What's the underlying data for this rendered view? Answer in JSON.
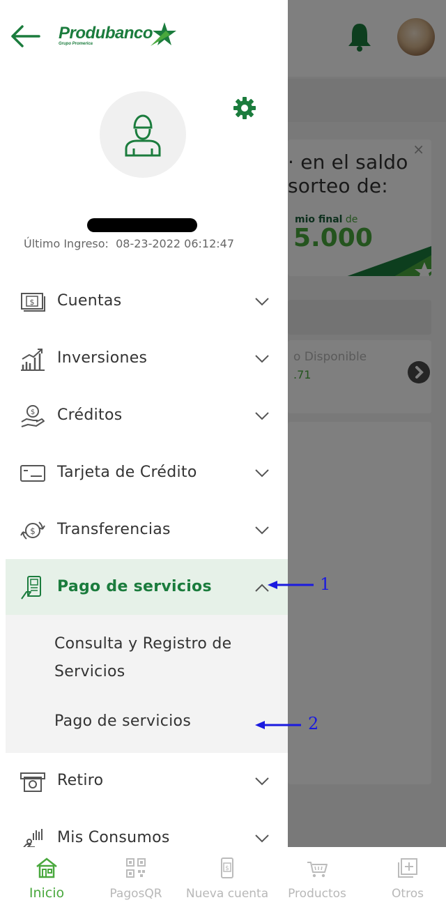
{
  "background": {
    "promo": {
      "close": "×",
      "line1": "· en el saldo",
      "line2": "sorteo de:",
      "prize_bold": "mio final",
      "prize_de": "de",
      "amount": "5.000"
    },
    "account": {
      "label": "o Disponible",
      "value": ".71"
    }
  },
  "drawer": {
    "last_login_label": "Último Ingreso:",
    "last_login_value": "08-23-2022 06:12:47",
    "logo_text": "Produbanco",
    "logo_sub": "Grupo Promerica",
    "menu": [
      {
        "label": "Cuentas",
        "icon": "cash-icon"
      },
      {
        "label": "Inversiones",
        "icon": "investment-chart-icon"
      },
      {
        "label": "Créditos",
        "icon": "credit-hand-icon"
      },
      {
        "label": "Tarjeta de Crédito",
        "icon": "credit-card-icon"
      },
      {
        "label": "Transferencias",
        "icon": "transfer-icon"
      },
      {
        "label": "Pago de servicios",
        "icon": "service-payment-icon",
        "expanded": true
      },
      {
        "label": "Retiro",
        "icon": "withdrawal-icon"
      },
      {
        "label": "Mis Consumos",
        "icon": "consumption-icon"
      }
    ],
    "submenu": {
      "item1": "Consulta y Registro de Servicios",
      "item2": "Pago de servicios"
    }
  },
  "annotations": {
    "marker1": "1",
    "marker2": "2"
  },
  "bottom_nav": [
    {
      "label": "Inicio",
      "icon": "home-icon",
      "active": true
    },
    {
      "label": "PagosQR",
      "icon": "qr-code-icon"
    },
    {
      "label": "Nueva cuenta",
      "icon": "new-account-icon"
    },
    {
      "label": "Productos",
      "icon": "cart-icon"
    },
    {
      "label": "Otros",
      "icon": "more-icon"
    }
  ],
  "colors": {
    "brand_green": "#1b7c3d",
    "accent_green": "#49a83d",
    "active_bg": "#e6f1e8",
    "annotation_blue": "#1a1adf"
  }
}
